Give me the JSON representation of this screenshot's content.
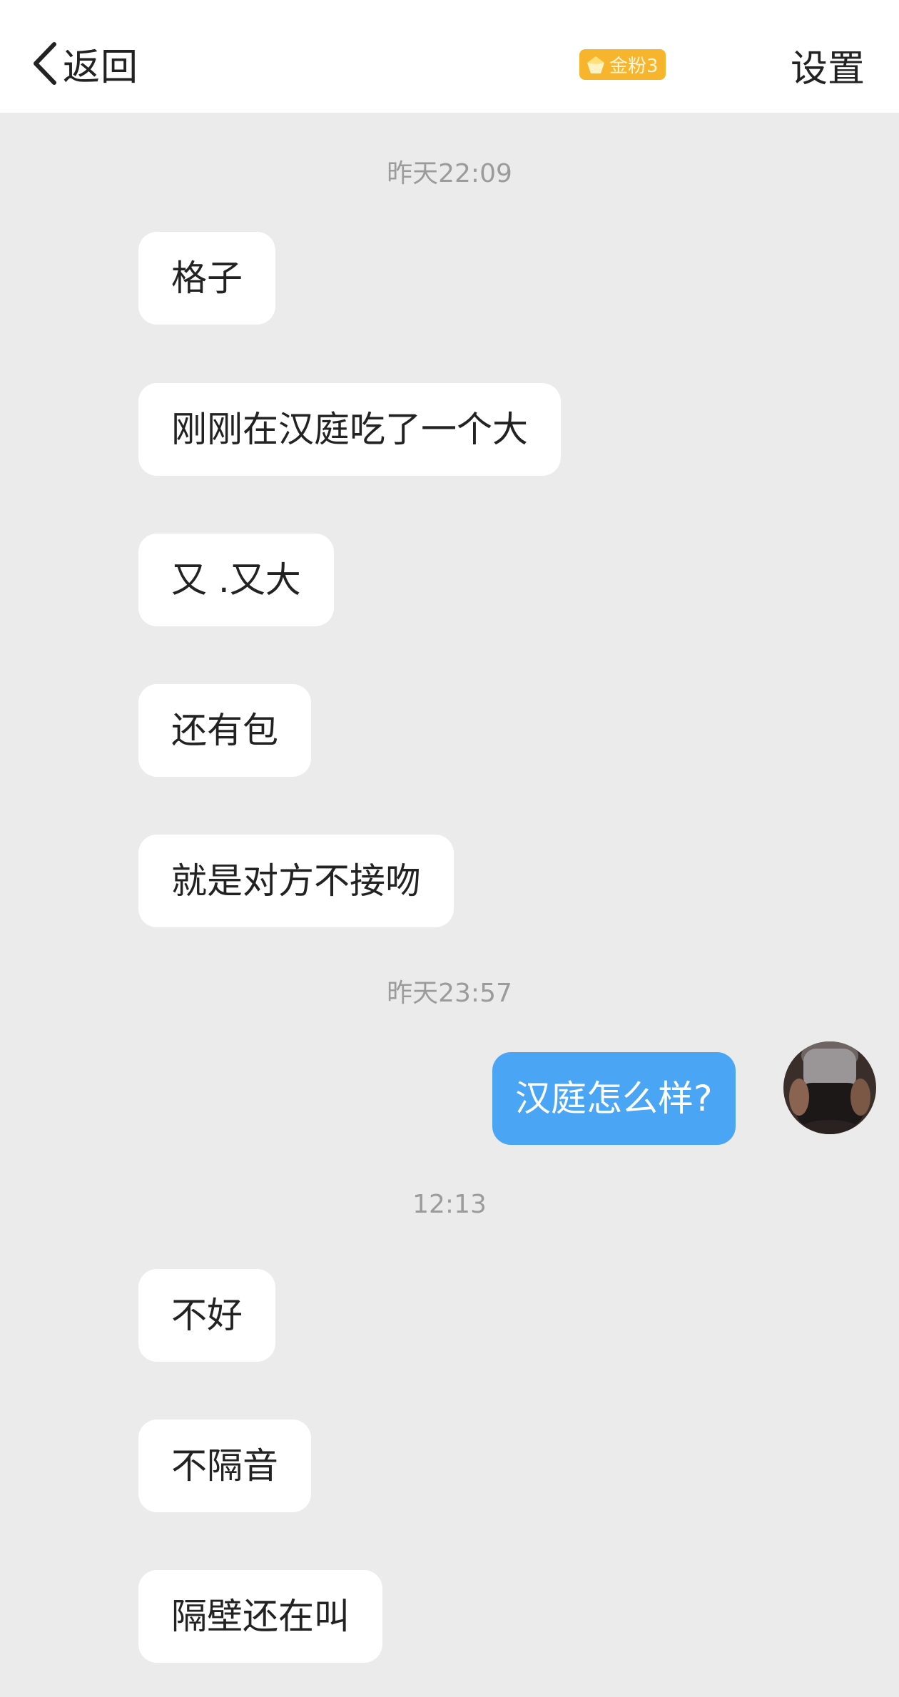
{
  "nav": {
    "back_label": "返回",
    "badge_label": "金粉3",
    "settings_label": "设置",
    "badge_color": "#f7b52e"
  },
  "chat": {
    "timestamps": [
      "昨天22:09",
      "昨天23:57",
      "12:13"
    ],
    "messages": [
      {
        "side": "left",
        "text": "格子"
      },
      {
        "side": "left",
        "text": "刚刚在汉庭吃了一个大"
      },
      {
        "side": "left",
        "text": "又 .又大"
      },
      {
        "side": "left",
        "text": "还有包"
      },
      {
        "side": "left",
        "text": "就是对方不接吻"
      },
      {
        "side": "right",
        "text": "汉庭怎么样?"
      },
      {
        "side": "left",
        "text": "不好"
      },
      {
        "side": "left",
        "text": "不隔音"
      },
      {
        "side": "left",
        "text": "隔壁还在叫"
      }
    ],
    "sent_bubble_color": "#4aa6f5"
  }
}
